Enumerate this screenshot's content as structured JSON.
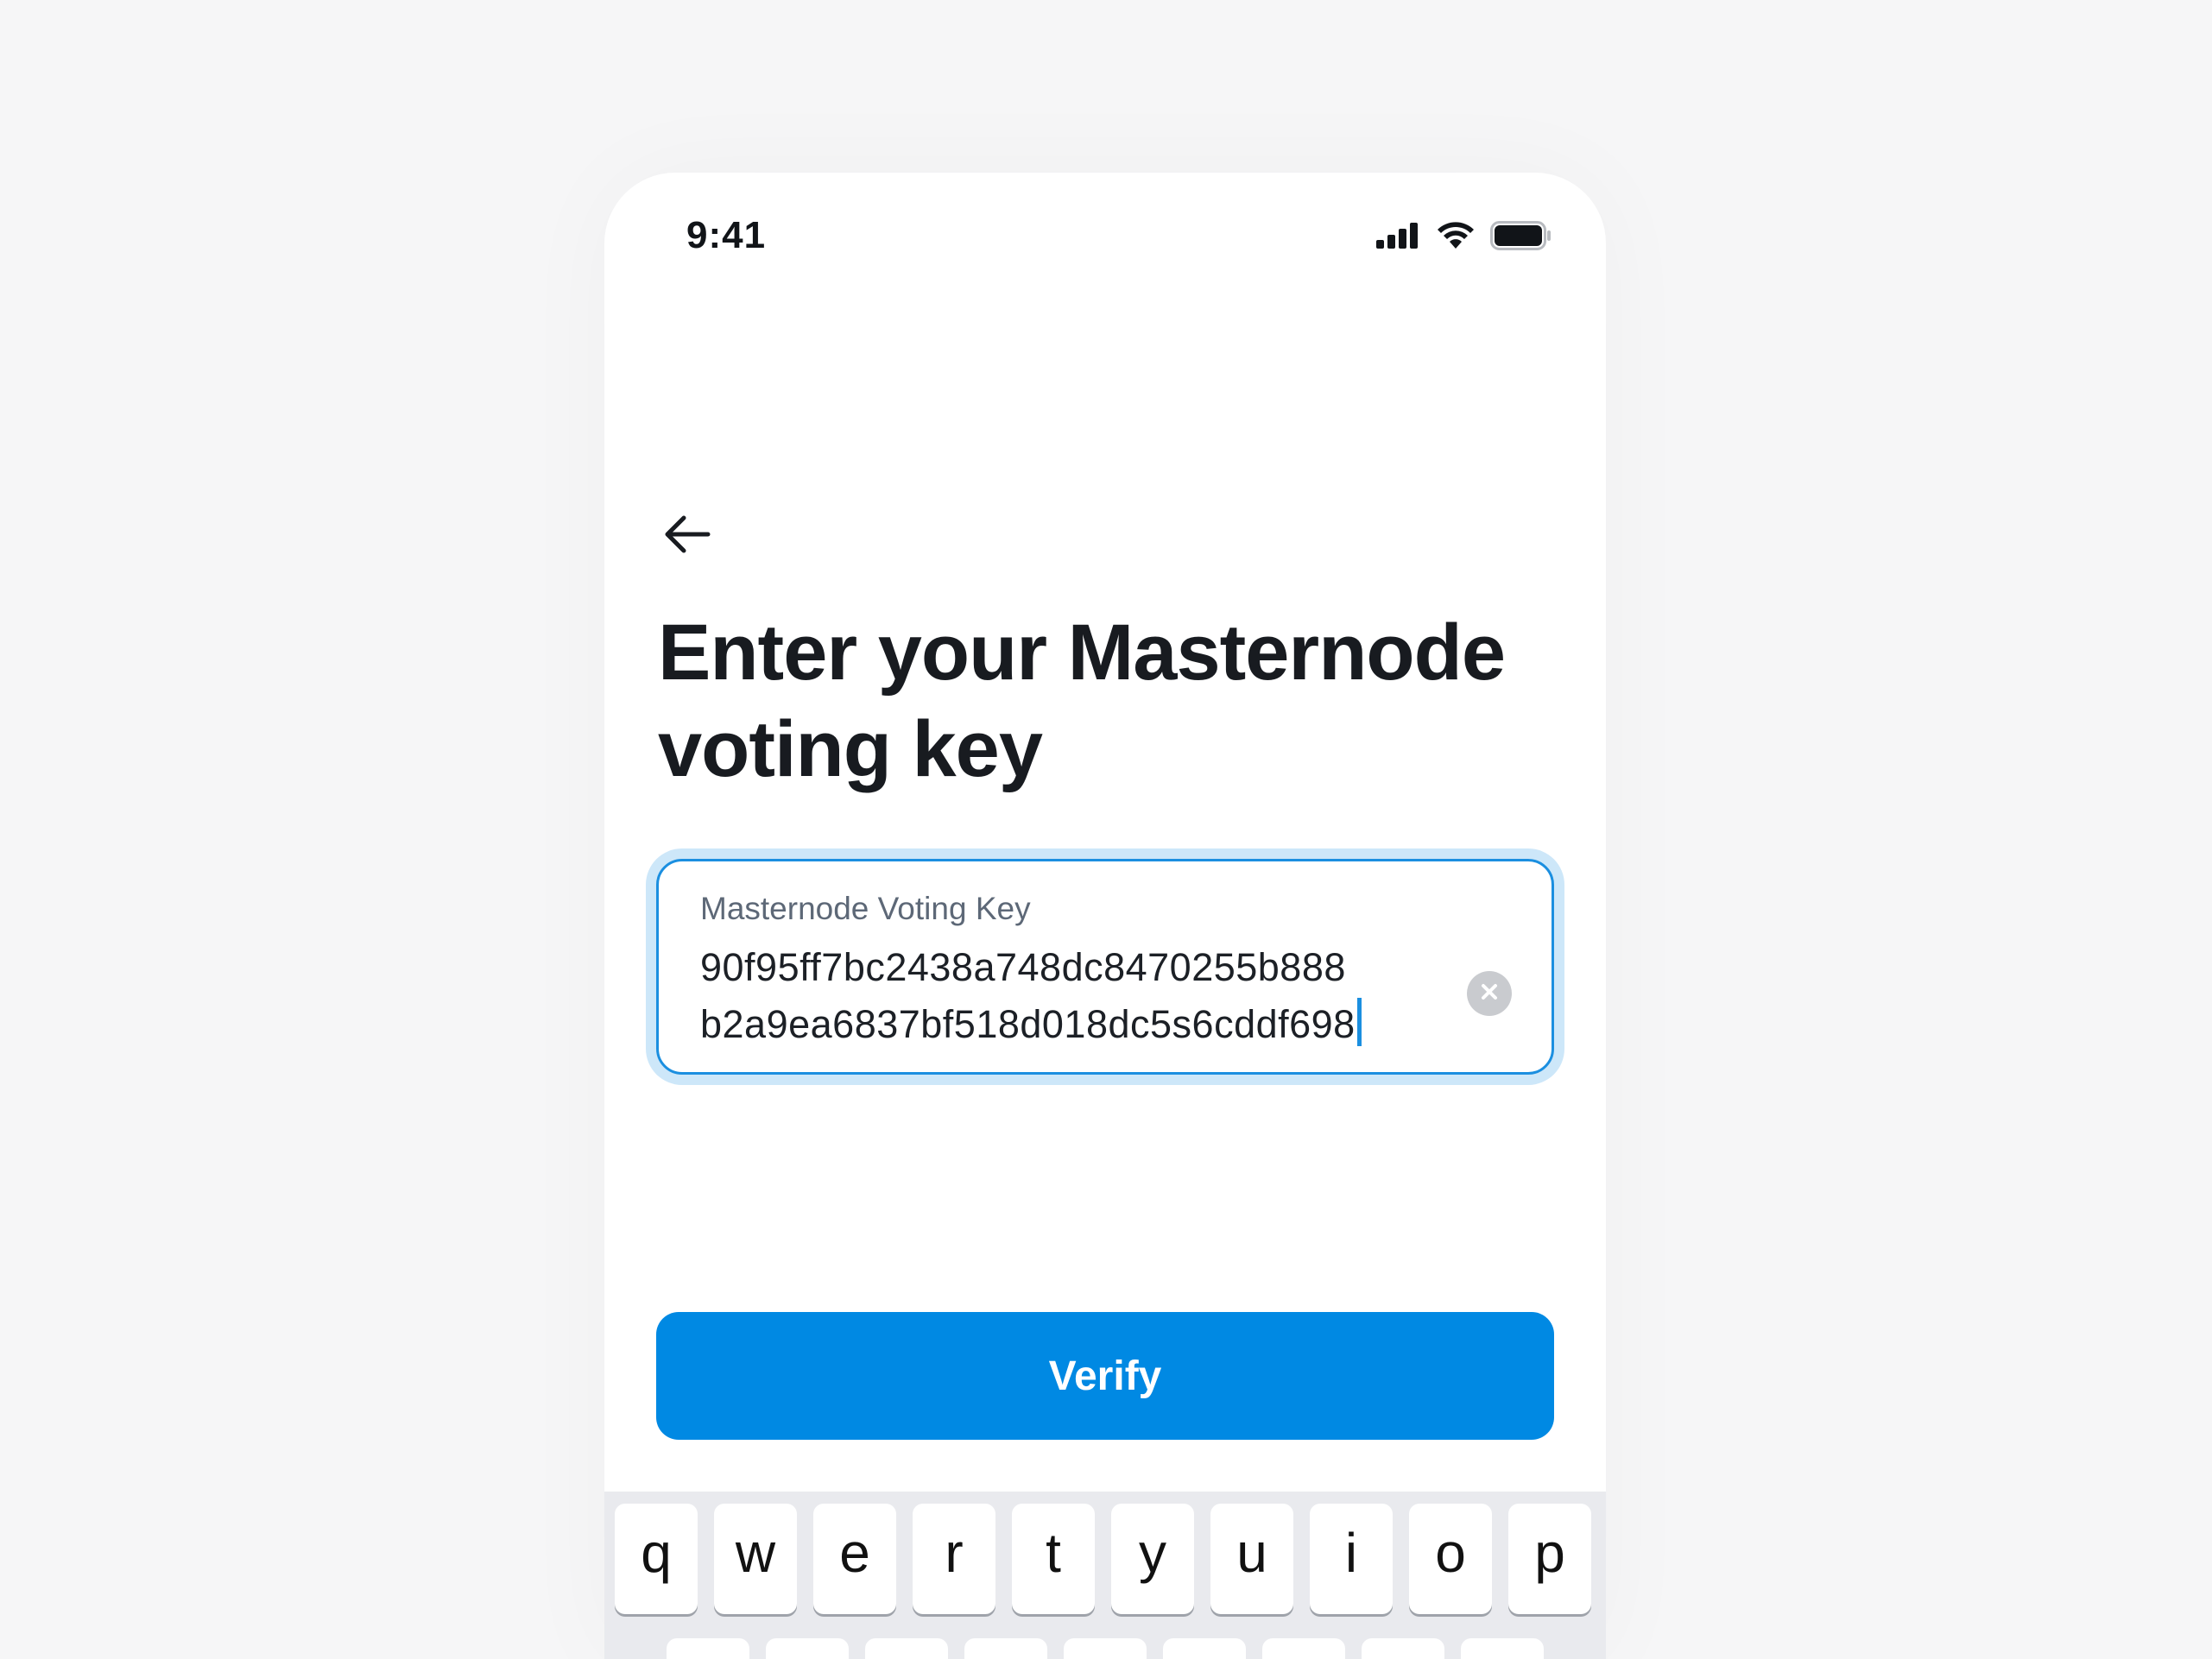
{
  "status_bar": {
    "time": "9:41",
    "icons": [
      "cellular-signal-icon",
      "wifi-icon",
      "battery-icon"
    ]
  },
  "header": {
    "back_icon": "arrow-left-icon",
    "title": "Enter your Masternode voting key"
  },
  "voting_key_field": {
    "label": "Masternode Voting Key",
    "value_line_1": "90f95ff7bc2438a748dc8470255b888",
    "value_line_2": "b2a9ea6837bf518d018dc5s6cddf698",
    "clear_icon": "clear-circle-icon"
  },
  "actions": {
    "verify_label": "Verify"
  },
  "keyboard": {
    "row_1": [
      "q",
      "w",
      "e",
      "r",
      "t",
      "y",
      "u",
      "i",
      "o",
      "p"
    ]
  },
  "colors": {
    "accent": "#0089e3",
    "focus_ring": "#cde7f9",
    "text_primary": "#181b20",
    "text_secondary": "#5d6877",
    "page_background": "#f6f6f7",
    "keyboard_background": "#e9eaee"
  }
}
